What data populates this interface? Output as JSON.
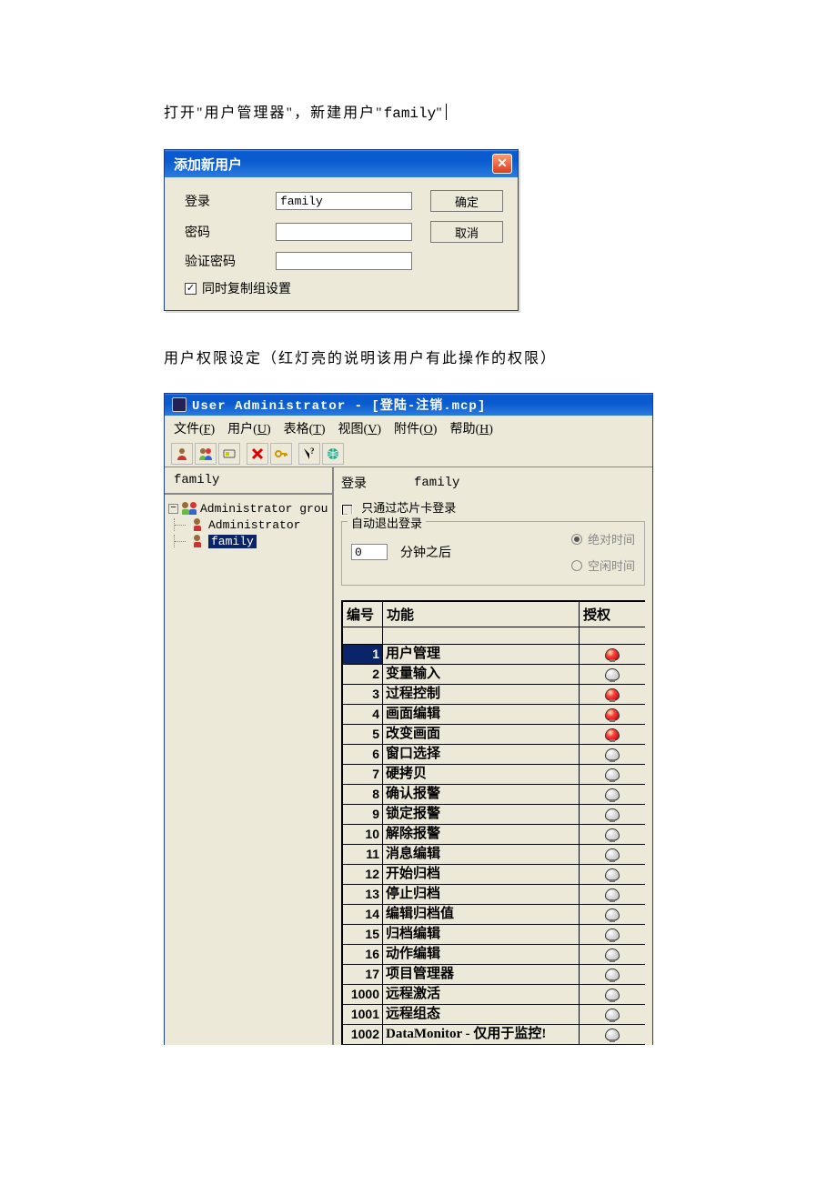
{
  "paragraphs": {
    "p1_a": "打开\"用户管理器\"，新建用户\"",
    "p1_b": "family",
    "p1_c": "\"",
    "p2": "用户权限设定（红灯亮的说明该用户有此操作的权限）"
  },
  "dialog": {
    "title": "添加新用户",
    "labels": {
      "login": "登录",
      "password": "密码",
      "verify": "验证密码",
      "copy": "同时复制组设置"
    },
    "login_value": "family",
    "buttons": {
      "ok": "确定",
      "cancel": "取消"
    },
    "copy_checked": true
  },
  "mainwin": {
    "title": "User Administrator - [登陆-注销.mcp]",
    "menus": {
      "file": {
        "text": "文件",
        "key": "F"
      },
      "user": {
        "text": "用户",
        "key": "U"
      },
      "table": {
        "text": "表格",
        "key": "T"
      },
      "view": {
        "text": "视图",
        "key": "V"
      },
      "addon": {
        "text": "附件",
        "key": "O"
      },
      "help": {
        "text": "帮助",
        "key": "H"
      }
    },
    "tree": {
      "header": "family",
      "root": "Administrator grou",
      "child_admin": "Administrator",
      "child_family": "family"
    },
    "right": {
      "login_label": "登录",
      "login_value": "family",
      "chipcard_label": "只通过芯片卡登录",
      "auto_logout_legend": "自动退出登录",
      "minutes_value": "0",
      "minutes_after": "分钟之后",
      "radio_abs": "绝对时间",
      "radio_idle": "空闲时间"
    },
    "table": {
      "headers": {
        "no": "编号",
        "func": "功能",
        "auth": "授权"
      },
      "rows": [
        {
          "no": "1",
          "func": "用户管理",
          "auth": true
        },
        {
          "no": "2",
          "func": "变量输入",
          "auth": false
        },
        {
          "no": "3",
          "func": "过程控制",
          "auth": true
        },
        {
          "no": "4",
          "func": "画面编辑",
          "auth": true
        },
        {
          "no": "5",
          "func": "改变画面",
          "auth": true
        },
        {
          "no": "6",
          "func": "窗口选择",
          "auth": false
        },
        {
          "no": "7",
          "func": "硬拷贝",
          "auth": false
        },
        {
          "no": "8",
          "func": "确认报警",
          "auth": false
        },
        {
          "no": "9",
          "func": "锁定报警",
          "auth": false
        },
        {
          "no": "10",
          "func": "解除报警",
          "auth": false
        },
        {
          "no": "11",
          "func": "消息编辑",
          "auth": false
        },
        {
          "no": "12",
          "func": "开始归档",
          "auth": false
        },
        {
          "no": "13",
          "func": "停止归档",
          "auth": false
        },
        {
          "no": "14",
          "func": "编辑归档值",
          "auth": false
        },
        {
          "no": "15",
          "func": "归档编辑",
          "auth": false
        },
        {
          "no": "16",
          "func": "动作编辑",
          "auth": false
        },
        {
          "no": "17",
          "func": "项目管理器",
          "auth": false
        },
        {
          "no": "1000",
          "func": "远程激活",
          "auth": false
        },
        {
          "no": "1001",
          "func": "远程组态",
          "auth": false
        },
        {
          "no": "1002",
          "func": "DataMonitor - 仅用于监控!",
          "auth": false
        }
      ]
    }
  }
}
